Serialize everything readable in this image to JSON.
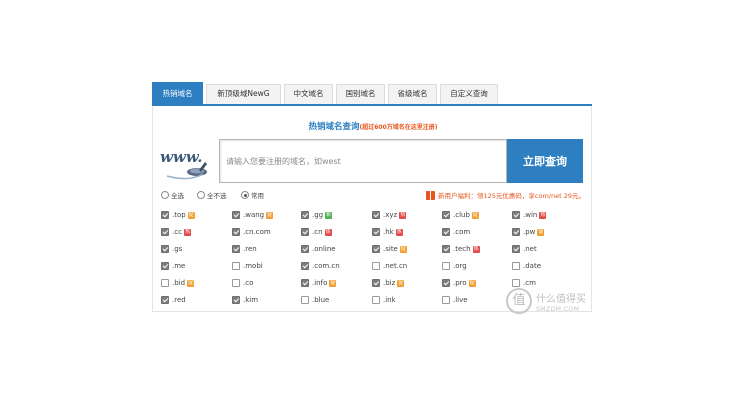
{
  "tabs": [
    {
      "label": "热销域名",
      "active": true
    },
    {
      "label": "新顶级域NewG",
      "active": false
    },
    {
      "label": "中文域名",
      "active": false
    },
    {
      "label": "国别域名",
      "active": false
    },
    {
      "label": "省级域名",
      "active": false
    },
    {
      "label": "自定义查询",
      "active": false
    }
  ],
  "search": {
    "title": "热销域名查询",
    "subtitle": "(超过600万域名在这里注册)",
    "placeholder": "请输入您要注册的域名，如west",
    "button_label": "立即查询",
    "logo_text": "www."
  },
  "options": [
    {
      "label": "全选",
      "checked": false
    },
    {
      "label": "全不选",
      "checked": false
    },
    {
      "label": "常用",
      "checked": true
    }
  ],
  "promo": {
    "text": "新用户福利：领125元优惠码，享com/net 29元。",
    "color": "#e8541c"
  },
  "badge_colors": {
    "orange": "#f0a030",
    "red": "#e04a4a",
    "green": "#4caf50"
  },
  "tlds": [
    [
      {
        "name": ".top",
        "checked": true,
        "badge": "促",
        "badge_color": "orange"
      },
      {
        "name": ".wang",
        "checked": true,
        "badge": "促",
        "badge_color": "orange"
      },
      {
        "name": ".gg",
        "checked": true,
        "badge": "新",
        "badge_color": "green"
      },
      {
        "name": ".xyz",
        "checked": true,
        "badge": "热",
        "badge_color": "red"
      },
      {
        "name": ".club",
        "checked": true,
        "badge": "促",
        "badge_color": "orange"
      },
      {
        "name": ".win",
        "checked": true,
        "badge": "热",
        "badge_color": "red"
      }
    ],
    [
      {
        "name": ".cc",
        "checked": true,
        "badge": "热",
        "badge_color": "red"
      },
      {
        "name": ".cn.com",
        "checked": true,
        "badge": "",
        "badge_color": ""
      },
      {
        "name": ".cn",
        "checked": true,
        "badge": "热",
        "badge_color": "red"
      },
      {
        "name": ".hk",
        "checked": true,
        "badge": "热",
        "badge_color": "red"
      },
      {
        "name": ".com",
        "checked": true,
        "badge": "",
        "badge_color": ""
      },
      {
        "name": ".pw",
        "checked": true,
        "badge": "促",
        "badge_color": "orange"
      }
    ],
    [
      {
        "name": ".gs",
        "checked": true,
        "badge": "",
        "badge_color": ""
      },
      {
        "name": ".ren",
        "checked": true,
        "badge": "",
        "badge_color": ""
      },
      {
        "name": ".online",
        "checked": true,
        "badge": "",
        "badge_color": ""
      },
      {
        "name": ".site",
        "checked": true,
        "badge": "促",
        "badge_color": "orange"
      },
      {
        "name": ".tech",
        "checked": true,
        "badge": "热",
        "badge_color": "red"
      },
      {
        "name": ".net",
        "checked": true,
        "badge": "",
        "badge_color": ""
      }
    ],
    [
      {
        "name": ".me",
        "checked": true,
        "badge": "",
        "badge_color": ""
      },
      {
        "name": ".mobi",
        "checked": false,
        "badge": "",
        "badge_color": ""
      },
      {
        "name": ".com.cn",
        "checked": true,
        "badge": "",
        "badge_color": ""
      },
      {
        "name": ".net.cn",
        "checked": false,
        "badge": "",
        "badge_color": ""
      },
      {
        "name": ".org",
        "checked": false,
        "badge": "",
        "badge_color": ""
      },
      {
        "name": ".date",
        "checked": false,
        "badge": "",
        "badge_color": ""
      }
    ],
    [
      {
        "name": ".bid",
        "checked": false,
        "badge": "促",
        "badge_color": "orange"
      },
      {
        "name": ".co",
        "checked": false,
        "badge": "",
        "badge_color": ""
      },
      {
        "name": ".info",
        "checked": true,
        "badge": "促",
        "badge_color": "orange"
      },
      {
        "name": ".biz",
        "checked": true,
        "badge": "促",
        "badge_color": "orange"
      },
      {
        "name": ".pro",
        "checked": true,
        "badge": "促",
        "badge_color": "orange"
      },
      {
        "name": ".cm",
        "checked": false,
        "badge": "",
        "badge_color": ""
      }
    ],
    [
      {
        "name": ".red",
        "checked": true,
        "badge": "",
        "badge_color": ""
      },
      {
        "name": ".kim",
        "checked": true,
        "badge": "",
        "badge_color": ""
      },
      {
        "name": ".blue",
        "checked": false,
        "badge": "",
        "badge_color": ""
      },
      {
        "name": ".ink",
        "checked": false,
        "badge": "",
        "badge_color": ""
      },
      {
        "name": ".live",
        "checked": false,
        "badge": "",
        "badge_color": ""
      },
      {
        "name": "",
        "checked": false,
        "badge": "",
        "badge_color": ""
      }
    ]
  ],
  "watermark": {
    "logo_char": "值",
    "text": "什么值得买",
    "sub": "SMZDM.COM"
  },
  "colors": {
    "accent": "#2d7fc1",
    "promo": "#e8541c"
  }
}
